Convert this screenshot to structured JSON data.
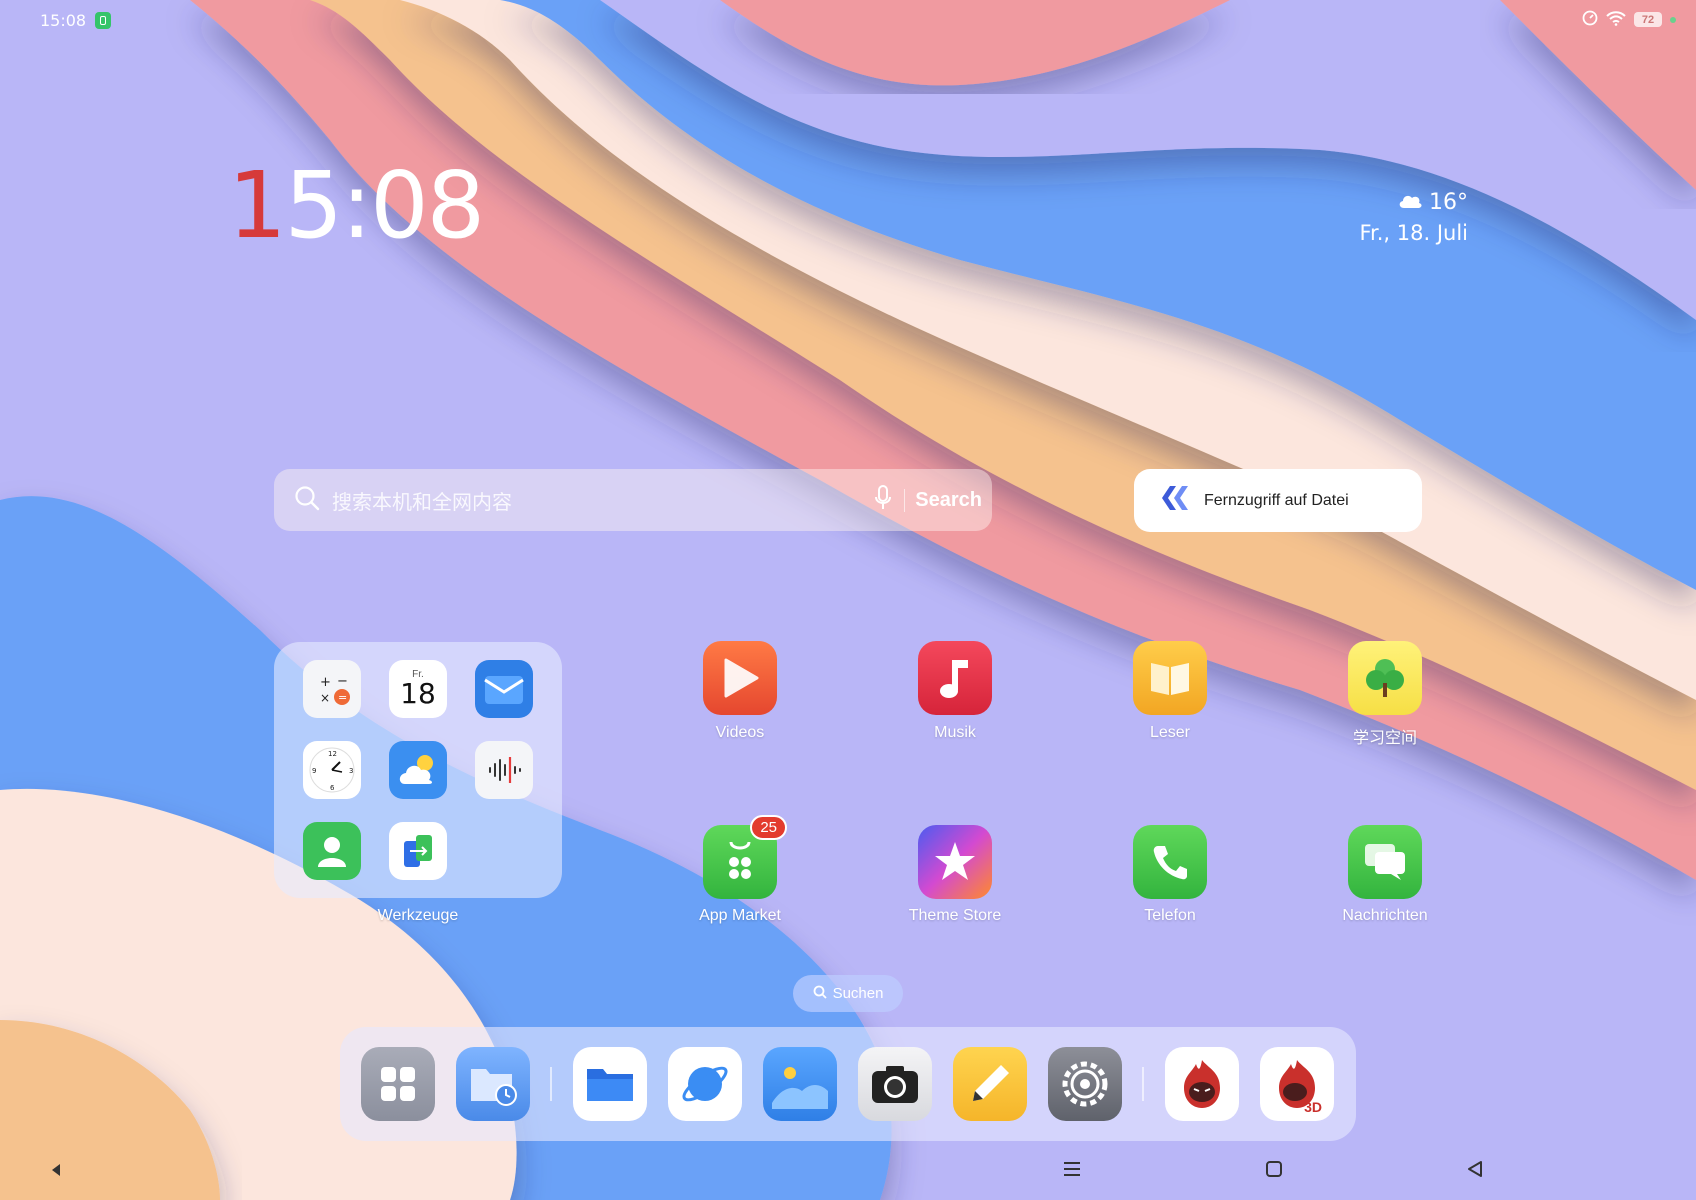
{
  "status_bar": {
    "time": "15:08",
    "battery": "72"
  },
  "clock": {
    "first_digit": "1",
    "rest": "5:08"
  },
  "weather": {
    "temperature": "16°",
    "date": "Fr., 18. Juli"
  },
  "search": {
    "placeholder": "搜索本机和全网内容",
    "button": "Search"
  },
  "remote_widget": {
    "label": "Fernzugriff auf Datei"
  },
  "folder": {
    "name": "Werkzeuge",
    "calendar_day_label": "Fr.",
    "calendar_day": "18"
  },
  "apps": [
    {
      "label": "Videos"
    },
    {
      "label": "Musik"
    },
    {
      "label": "Leser"
    },
    {
      "label": "学习空间"
    },
    {
      "label": "App Market",
      "badge": "25"
    },
    {
      "label": "Theme Store"
    },
    {
      "label": "Telefon"
    },
    {
      "label": "Nachrichten"
    }
  ],
  "suchen": {
    "label": "Suchen"
  },
  "dock": {
    "antutu_3d_label": "3D"
  }
}
